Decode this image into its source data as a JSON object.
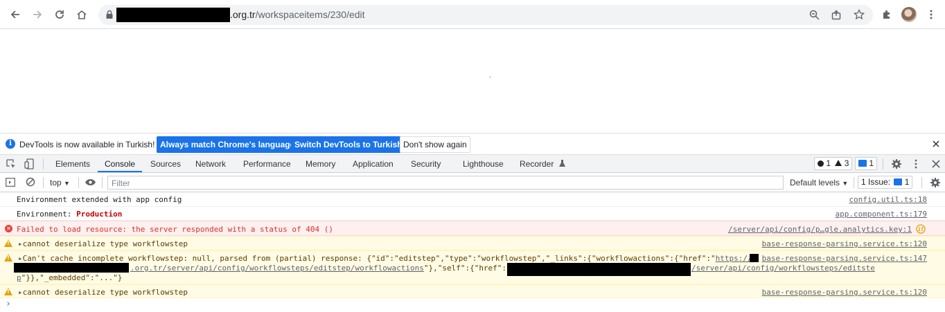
{
  "browser": {
    "url_domain_suffix": ".org.tr",
    "url_path": "/workspaceitems/230/edit"
  },
  "infobar": {
    "message": "DevTools is now available in Turkish!",
    "btn_match": "Always match Chrome's language",
    "btn_switch": "Switch DevTools to Turkish",
    "btn_dont_show": "Don't show again"
  },
  "devtools": {
    "tabs": [
      "Elements",
      "Console",
      "Sources",
      "Network",
      "Performance",
      "Memory",
      "Application",
      "Security",
      "Lighthouse",
      "Recorder"
    ],
    "active_tab": "Console",
    "errors_count": "1",
    "warnings_count": "3",
    "messages_count": "1"
  },
  "console_bar": {
    "context": "top",
    "filter_placeholder": "Filter",
    "levels": "Default levels",
    "issues": "1 Issue:",
    "issues_count": "1"
  },
  "messages": [
    {
      "level": "info",
      "text": "Environment extended with app config",
      "source": "config.util.ts:18"
    },
    {
      "level": "info",
      "text_prefix": "Environment: ",
      "text_emph": "Production",
      "source": "app.component.ts:179"
    },
    {
      "level": "error",
      "text": "Failed to load resource: the server responded with a status of 404 ()",
      "source": "/server/api/config/p…gle.analytics.key:1"
    },
    {
      "level": "warn",
      "text": "cannot deserialize type workflowstep",
      "source": "base-response-parsing.service.ts:120"
    },
    {
      "level": "warn",
      "line1": "Can't cache incomplete workflowstep: null, parsed from (partial) response: {\"id\":\"editstep\",\"type\":\"workflowstep\",\"_links\":{\"workflowactions\":{\"href\":\"",
      "line1_link": "https://",
      "line2_link": ".org.tr/server/api/config/workflowsteps/editstep/workflowactions",
      "line2_mid": "\"},\"self\":{\"href\":\"",
      "line2_link2": "/server/api/config/workflowsteps/editste",
      "line3_link": "p",
      "line3_rest": "\"}},\"_embedded\":\"...\"}",
      "source": "base-response-parsing.service.ts:147"
    },
    {
      "level": "warn",
      "text": "cannot deserialize type workflowstep",
      "source": "base-response-parsing.service.ts:120"
    }
  ],
  "prompt": "›"
}
